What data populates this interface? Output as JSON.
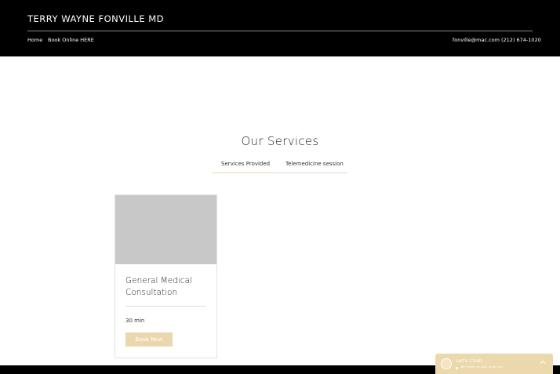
{
  "header": {
    "site_title": "TERRY WAYNE FONVILLE MD",
    "nav": {
      "home": "Home",
      "book_online": "Book Online HERE"
    },
    "contact": {
      "email": "fonville@mac.com",
      "phone": "(212) 674-1020"
    }
  },
  "services": {
    "title": "Our Services",
    "tabs": [
      {
        "label": "Services Provided",
        "selected": true
      },
      {
        "label": "Telemedicine session",
        "selected": false
      }
    ],
    "cards": [
      {
        "title": "General Medical Consultation",
        "duration": "30 min",
        "button_label": "Book Now"
      }
    ]
  },
  "chat": {
    "title": "Let's Chat!",
    "subtitle": "We'll reply as soon as we can",
    "icons": {
      "avatar": "chat-avatar-icon",
      "chevron": "chevron-up-icon"
    }
  },
  "colors": {
    "header_bg": "#000000",
    "accent_gold": "#ead7ad",
    "card_image": "#c8c8c8"
  }
}
